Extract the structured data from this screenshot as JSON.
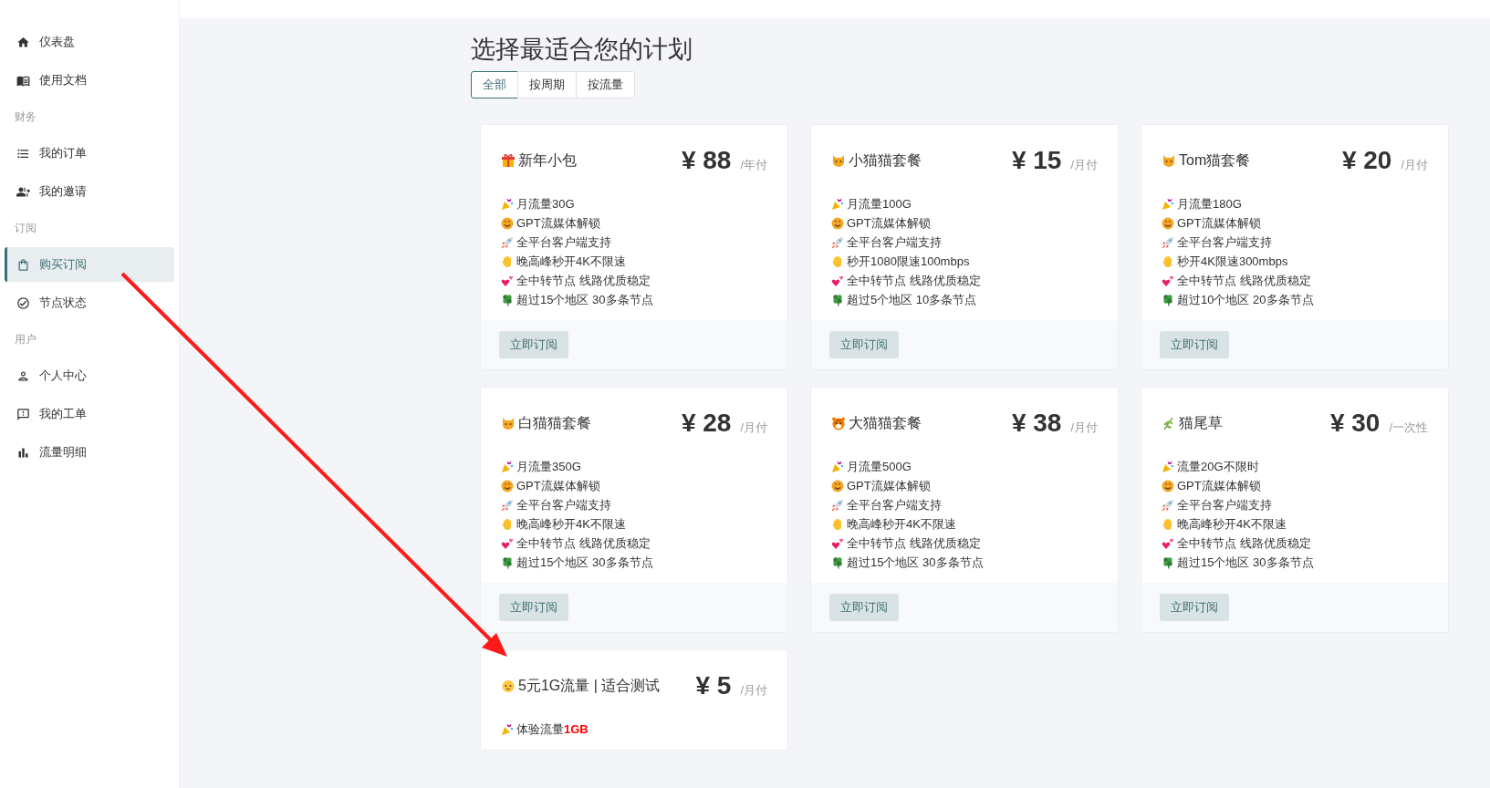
{
  "sidebar": {
    "groups": [
      {
        "items": [
          {
            "kind": "home",
            "label": "仪表盘",
            "selected": false
          },
          {
            "kind": "book",
            "label": "使用文档",
            "selected": false
          }
        ]
      },
      {
        "label": "财务",
        "items": [
          {
            "kind": "list",
            "label": "我的订单",
            "selected": false
          },
          {
            "kind": "invite",
            "label": "我的邀请",
            "selected": false
          }
        ]
      },
      {
        "label": "订阅",
        "items": [
          {
            "kind": "bag",
            "label": "购买订阅",
            "selected": true
          },
          {
            "kind": "check",
            "label": "节点状态",
            "selected": false
          }
        ]
      },
      {
        "label": "用户",
        "items": [
          {
            "kind": "user",
            "label": "个人中心",
            "selected": false
          },
          {
            "kind": "ticket",
            "label": "我的工单",
            "selected": false
          },
          {
            "kind": "chart",
            "label": "流量明细",
            "selected": false
          }
        ]
      }
    ]
  },
  "page": {
    "title": "选择最适合您的计划"
  },
  "tabs": [
    {
      "label": "全部",
      "selected": true
    },
    {
      "label": "按周期",
      "selected": false
    },
    {
      "label": "按流量",
      "selected": false
    }
  ],
  "plans": [
    {
      "kind": "gift",
      "name": "新年小包",
      "price": "¥ 88",
      "period": "/年付",
      "features": [
        {
          "text": "月流量30G"
        },
        {
          "text": "GPT流媒体解锁"
        },
        {
          "text": "全平台客户端支持"
        },
        {
          "text": "晚高峰秒开4K不限速"
        },
        {
          "text": "全中转节点 线路优质稳定"
        },
        {
          "text": "超过15个地区 30多条节点"
        }
      ],
      "button": "立即订阅"
    },
    {
      "kind": "cat",
      "name": "小猫猫套餐",
      "price": "¥ 15",
      "period": "/月付",
      "features": [
        {
          "text": "月流量100G"
        },
        {
          "text": "GPT流媒体解锁"
        },
        {
          "text": "全平台客户端支持"
        },
        {
          "text": "秒开1080限速100mbps"
        },
        {
          "text": "全中转节点 线路优质稳定"
        },
        {
          "text": "超过5个地区 10多条节点"
        }
      ],
      "button": "立即订阅"
    },
    {
      "kind": "cat",
      "name": "Tom猫套餐",
      "price": "¥ 20",
      "period": "/月付",
      "features": [
        {
          "text": "月流量180G"
        },
        {
          "text": "GPT流媒体解锁"
        },
        {
          "text": "全平台客户端支持"
        },
        {
          "text": "秒开4K限速300mbps"
        },
        {
          "text": "全中转节点 线路优质稳定"
        },
        {
          "text": "超过10个地区 20多条节点"
        }
      ],
      "button": "立即订阅"
    },
    {
      "kind": "cat",
      "name": "白猫猫套餐",
      "price": "¥ 28",
      "period": "/月付",
      "features": [
        {
          "text": "月流量350G"
        },
        {
          "text": "GPT流媒体解锁"
        },
        {
          "text": "全平台客户端支持"
        },
        {
          "text": "晚高峰秒开4K不限速"
        },
        {
          "text": "全中转节点 线路优质稳定"
        },
        {
          "text": "超过15个地区 30多条节点"
        }
      ],
      "button": "立即订阅"
    },
    {
      "kind": "tiger",
      "name": "大猫猫套餐",
      "price": "¥ 38",
      "period": "/月付",
      "features": [
        {
          "text": "月流量500G"
        },
        {
          "text": "GPT流媒体解锁"
        },
        {
          "text": "全平台客户端支持"
        },
        {
          "text": "晚高峰秒开4K不限速"
        },
        {
          "text": "全中转节点 线路优质稳定"
        },
        {
          "text": "超过15个地区 30多条节点"
        }
      ],
      "button": "立即订阅"
    },
    {
      "kind": "herb",
      "name": "猫尾草",
      "price": "¥ 30",
      "period": "/一次性",
      "features": [
        {
          "text": "流量20G不限时"
        },
        {
          "text": "GPT流媒体解锁"
        },
        {
          "text": "全平台客户端支持"
        },
        {
          "text": "晚高峰秒开4K不限速"
        },
        {
          "text": "全中转节点 线路优质稳定"
        },
        {
          "text": "超过15个地区 30多条节点"
        }
      ],
      "button": "立即订阅"
    },
    {
      "kind": "baby",
      "name": "5元1G流量 | 适合测试",
      "price": "¥ 5",
      "period": "/月付",
      "features": [
        {
          "text": "体验流量",
          "highlight": "1GB"
        }
      ]
    }
  ]
}
